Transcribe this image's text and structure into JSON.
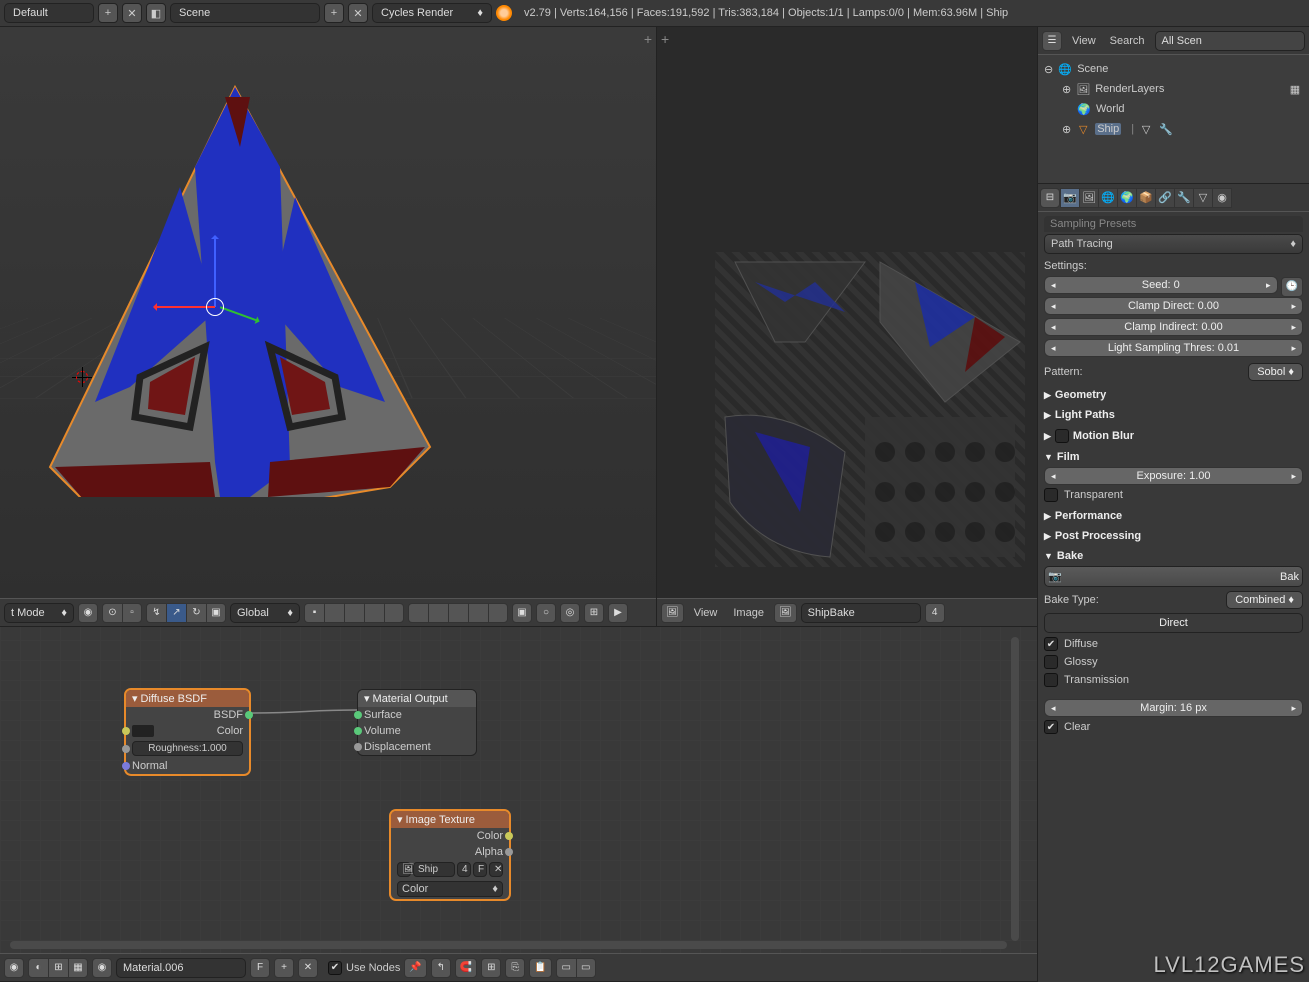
{
  "header": {
    "layout": "Default",
    "scene": "Scene",
    "engine": "Cycles Render",
    "version": "v2.79",
    "stats": "Verts:164,156 | Faces:191,592 | Tris:383,184 | Objects:1/1 | Lamps:0/0 | Mem:63.96M | Ship"
  },
  "outliner": {
    "view": "View",
    "search": "Search",
    "filter": "All Scen",
    "tree": {
      "scene": "Scene",
      "renderlayers": "RenderLayers",
      "world": "World",
      "ship": "Ship"
    }
  },
  "viewport3d": {
    "mode": "t Mode",
    "orientation": "Global"
  },
  "uv_editor": {
    "view": "View",
    "image": "Image",
    "image_name": "ShipBake",
    "users": "4"
  },
  "node_editor": {
    "material_name": "Material.006",
    "fake_user": "F",
    "use_nodes_label": "Use Nodes",
    "nodes": {
      "diffuse": {
        "title": "Diffuse BSDF",
        "out_bsdf": "BSDF",
        "in_color": "Color",
        "roughness": "Roughness:1.000",
        "in_normal": "Normal"
      },
      "output": {
        "title": "Material Output",
        "surface": "Surface",
        "volume": "Volume",
        "displacement": "Displacement"
      },
      "imgtex": {
        "title": "Image Texture",
        "out_color": "Color",
        "out_alpha": "Alpha",
        "img": "Ship",
        "img_users": "4",
        "img_f": "F",
        "colorspace": "Color"
      }
    }
  },
  "properties": {
    "sampling_header": "Sampling Presets",
    "integrator": "Path Tracing",
    "settings_label": "Settings:",
    "seed": {
      "label": "Seed:",
      "value": "0"
    },
    "clamp_direct": {
      "label": "Clamp Direct:",
      "value": "0.00"
    },
    "clamp_indirect": {
      "label": "Clamp Indirect:",
      "value": "0.00"
    },
    "light_thres": {
      "label": "Light Sampling Thres:",
      "value": "0.01"
    },
    "pattern": {
      "label": "Pattern:",
      "value": "Sobol"
    },
    "panels": {
      "geometry": "Geometry",
      "light_paths": "Light Paths",
      "motion_blur": "Motion Blur",
      "film": "Film",
      "performance": "Performance",
      "post_processing": "Post Processing",
      "bake": "Bake"
    },
    "film": {
      "exposure": {
        "label": "Exposure:",
        "value": "1.00"
      },
      "transparent": "Transparent"
    },
    "bake": {
      "button": "Bak",
      "type_label": "Bake Type:",
      "type_value": "Combined",
      "direct": "Direct",
      "diffuse": "Diffuse",
      "glossy": "Glossy",
      "transmission": "Transmission",
      "margin": {
        "label": "Margin:",
        "value": "16 px"
      },
      "clear": "Clear"
    }
  },
  "watermark": "LVL12GAMES"
}
